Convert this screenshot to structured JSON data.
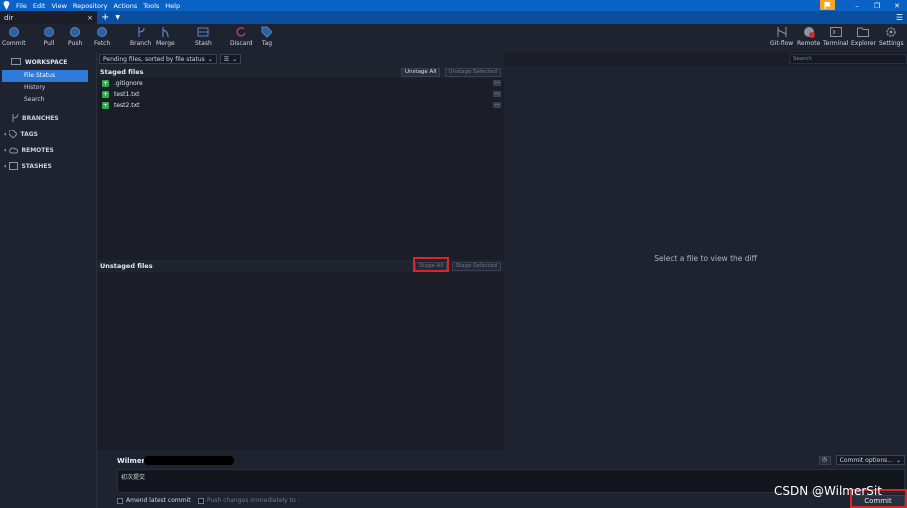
{
  "menu": [
    "File",
    "Edit",
    "View",
    "Repository",
    "Actions",
    "Tools",
    "Help"
  ],
  "tab": {
    "name": "dir",
    "close": "×",
    "add": "+"
  },
  "toolbar": {
    "left": [
      {
        "label": "Commit",
        "icon": "commit-icon"
      },
      {
        "label": "Pull",
        "icon": "pull-icon"
      },
      {
        "label": "Push",
        "icon": "push-icon"
      },
      {
        "label": "Fetch",
        "icon": "fetch-icon"
      },
      {
        "label": "Branch",
        "icon": "branch-icon"
      },
      {
        "label": "Merge",
        "icon": "merge-icon"
      },
      {
        "label": "Stash",
        "icon": "stash-icon"
      },
      {
        "label": "Discard",
        "icon": "discard-icon"
      },
      {
        "label": "Tag",
        "icon": "tag-icon"
      }
    ],
    "right": [
      {
        "label": "Git-flow",
        "icon": "git-flow-icon"
      },
      {
        "label": "Remote",
        "icon": "remote-icon"
      },
      {
        "label": "Terminal",
        "icon": "terminal-icon"
      },
      {
        "label": "Explorer",
        "icon": "explorer-icon"
      },
      {
        "label": "Settings",
        "icon": "settings-icon"
      }
    ]
  },
  "sidebar": {
    "workspace": "WORKSPACE",
    "items": [
      "File Status",
      "History",
      "Search"
    ],
    "sections": [
      "BRANCHES",
      "TAGS",
      "REMOTES",
      "STASHES"
    ]
  },
  "filter": {
    "sort": "Pending files, sorted by file status",
    "view": "☰"
  },
  "staged": {
    "title": "Staged files",
    "unstage_all": "Unstage All",
    "unstage_selected": "Unstage Selected",
    "files": [
      ".gitignore",
      "test1.txt",
      "test2.txt"
    ]
  },
  "unstaged": {
    "title": "Unstaged files",
    "stage_all": "Stage All",
    "stage_selected": "Stage Selected"
  },
  "diff": {
    "placeholder": "Select a file to view the diff"
  },
  "search": {
    "placeholder": "Search"
  },
  "commit": {
    "author": "Wilmer",
    "message": "初次提交",
    "amend": "Amend latest commit",
    "push_now": "Push changes immediately to -",
    "options": "Commit options...",
    "button": "Commit"
  },
  "watermark": "CSDN @WilmerSit",
  "colors": {
    "accent": "#2d7ad8",
    "titlebar": "#0a62c6",
    "highlight": "#d9262b",
    "added": "#2fa84f"
  }
}
